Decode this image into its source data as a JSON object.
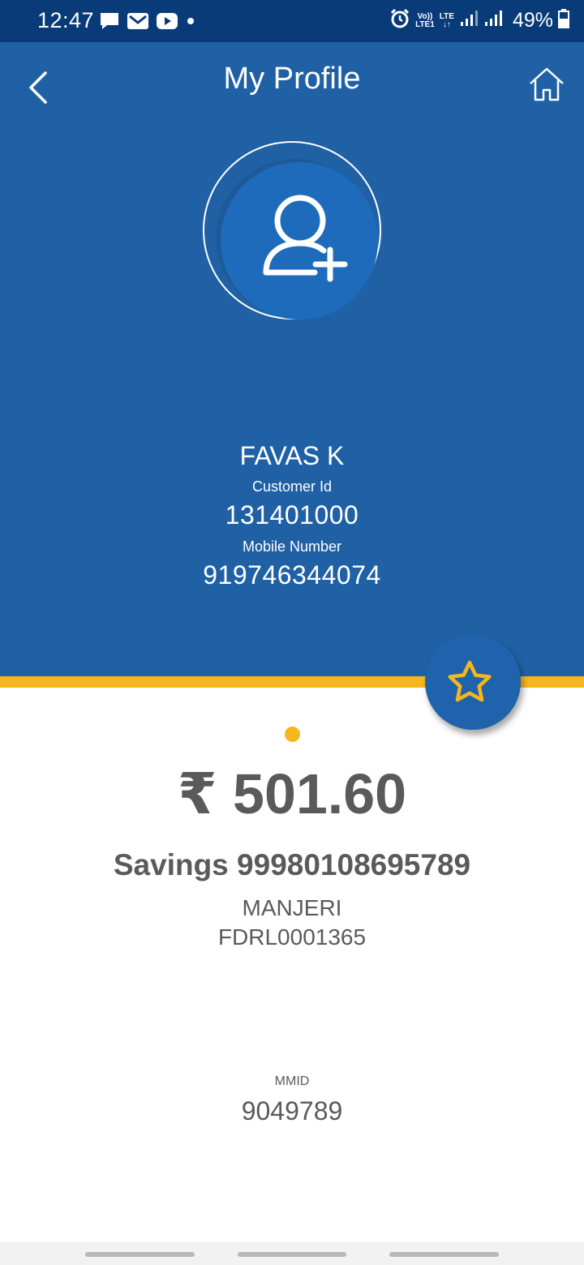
{
  "status_bar": {
    "time": "12:47",
    "battery": "49%",
    "network_vo": "Vo))",
    "network_lte1": "LTE1",
    "network_lte": "LTE",
    "icons": [
      "chat-icon",
      "gmail-icon",
      "youtube-icon",
      "dot-icon",
      "alarm-icon",
      "signal-icon",
      "signal-icon",
      "battery-icon"
    ]
  },
  "header": {
    "title": "My Profile",
    "back_icon": "chevron-left-icon",
    "home_icon": "home-icon",
    "background": "#2060a4"
  },
  "profile": {
    "avatar_icon": "add-user-icon",
    "name": "FAVAS K",
    "customer_id_label": "Customer Id",
    "customer_id": "131401000",
    "mobile_label": "Mobile Number",
    "mobile": "919746344074"
  },
  "account": {
    "favorite_icon": "star-icon",
    "balance": "₹ 501.60",
    "account_line": "Savings 99980108695789",
    "branch": "MANJERI",
    "ifsc": "FDRL0001365",
    "mmid_label": "MMID",
    "mmid": "9049789",
    "accent": "#f6b71d"
  }
}
